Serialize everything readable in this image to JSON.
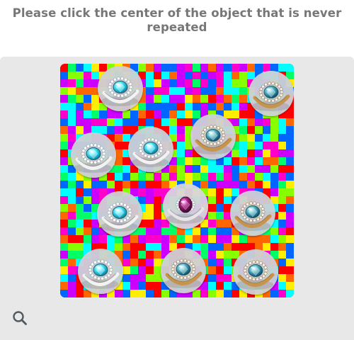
{
  "instruction": {
    "text": "Please click the center of the object that is never repeated"
  },
  "puzzle": {
    "description": "Noisy pixel mosaic background with ring photographs; one ring appears once",
    "palette": [
      "#ff0000",
      "#ff6600",
      "#ffee00",
      "#88ff00",
      "#00ff66",
      "#00ffff",
      "#0066ff",
      "#cc00ff",
      "#ff00cc"
    ],
    "items": [
      {
        "name": "oval-aqua-halo-ring",
        "style": "aqua"
      },
      {
        "name": "teal-gold-halo-ring",
        "style": "teal-gold"
      },
      {
        "name": "oval-aqua-halo-ring",
        "style": "aqua"
      },
      {
        "name": "oval-aqua-halo-ring",
        "style": "aqua"
      },
      {
        "name": "teal-gold-halo-ring",
        "style": "teal-gold"
      },
      {
        "name": "oval-aqua-halo-ring",
        "style": "aqua"
      },
      {
        "name": "purple-unique-ring",
        "style": "purple"
      },
      {
        "name": "teal-gold-halo-ring",
        "style": "teal-gold"
      },
      {
        "name": "oval-aqua-halo-ring",
        "style": "aqua"
      },
      {
        "name": "teal-gold-halo-ring",
        "style": "teal-gold"
      },
      {
        "name": "teal-gold-halo-ring",
        "style": "teal-gold"
      }
    ]
  },
  "controls": {
    "search_icon": "search-icon"
  }
}
